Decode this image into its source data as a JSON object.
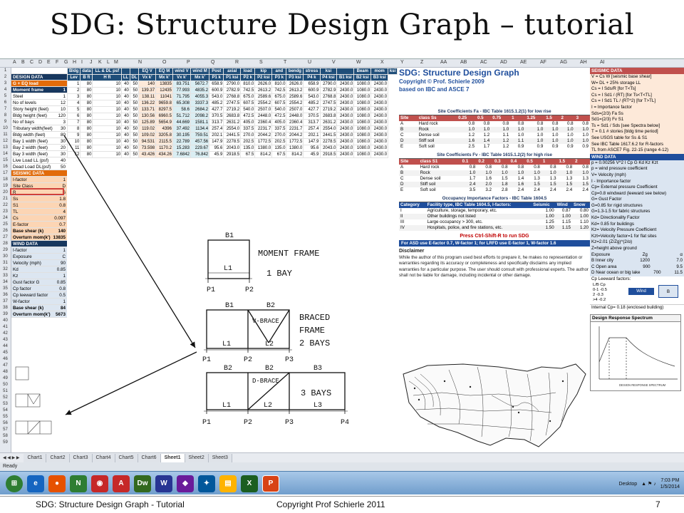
{
  "title": "SDG: Structure Design Graph – tutorial",
  "excel": {
    "columns": [
      "A",
      "B",
      "C",
      "D",
      "E",
      "F",
      "G",
      "H",
      "I",
      "J",
      "K",
      "L",
      "M",
      "N",
      "O",
      "P",
      "Q",
      "R",
      "S",
      "T",
      "U",
      "V",
      "W",
      "X",
      "Y",
      "Z",
      "AA",
      "AB",
      "AC",
      "AD",
      "AE",
      "AF",
      "AG",
      "AH",
      "AI"
    ],
    "rows": [
      "1",
      "2",
      "3",
      "4",
      "5",
      "6",
      "7",
      "8",
      "9",
      "10",
      "11",
      "12",
      "13",
      "14",
      "15",
      "16",
      "17",
      "18",
      "19",
      "20",
      "21",
      "22",
      "23",
      "24",
      "25",
      "26",
      "27",
      "28",
      "29",
      "30",
      "31",
      "32",
      "33",
      "34",
      "35",
      "36",
      "37",
      "38",
      "39",
      "40",
      "41",
      "42",
      "43",
      "44",
      "45",
      "46",
      "47",
      "48",
      "49",
      "50",
      "51",
      "52",
      "53",
      "54",
      "55",
      "56",
      "57",
      "58",
      "59"
    ],
    "left": [
      {
        "label": "",
        "value": "",
        "style": ""
      },
      {
        "label": "DESIGN DATA",
        "value": "",
        "style": "hb"
      },
      {
        "label": "G + EQ load",
        "value": "",
        "style": "h"
      },
      {
        "label": "Moment frame",
        "value": "1",
        "style": "hb"
      },
      {
        "label": "Steel",
        "value": "1",
        "style": ""
      },
      {
        "label": "No of levels",
        "value": "12",
        "style": ""
      },
      {
        "label": "Story height (feet)",
        "value": "10",
        "style": ""
      },
      {
        "label": "Bldg height (feet)",
        "value": "120",
        "style": ""
      },
      {
        "label": "No of bays",
        "value": "3",
        "style": ""
      },
      {
        "label": "Tributary width(feet)",
        "value": "30",
        "style": ""
      },
      {
        "label": "Bldg width (feet)",
        "value": "80",
        "style": ""
      },
      {
        "label": "Bay 1 width (feet)",
        "value": "30",
        "style": ""
      },
      {
        "label": "Bay 2 width (feet)",
        "value": "20",
        "style": ""
      },
      {
        "label": "Bay 3 width (feet)",
        "value": "30",
        "style": ""
      },
      {
        "label": "Live Load LL (psf)",
        "value": "40",
        "style": ""
      },
      {
        "label": "Dead Load DL(psf)",
        "value": "50",
        "style": ""
      },
      {
        "label": "SEISMIC DATA",
        "value": "",
        "style": "h"
      },
      {
        "label": "I-factor",
        "value": "1",
        "style": "o"
      },
      {
        "label": "Site Class",
        "value": "D",
        "style": "o"
      },
      {
        "label": "R",
        "value": "6",
        "style": "o"
      },
      {
        "label": "Ss",
        "value": "1.8",
        "style": "o"
      },
      {
        "label": "S1",
        "value": "0.8",
        "style": "o"
      },
      {
        "label": "TL",
        "value": "4",
        "style": "o"
      },
      {
        "label": "Cs",
        "value": "0.097",
        "style": "o"
      },
      {
        "label": "E-factor",
        "value": "0.7",
        "style": "o"
      },
      {
        "label": "Base shear (k)",
        "value": "140",
        "style": "o bold"
      },
      {
        "label": "Overturn mom(k')",
        "value": "13835",
        "style": "o bold"
      },
      {
        "label": "WIND DATA",
        "value": "",
        "style": "hb"
      },
      {
        "label": "I-factor",
        "value": "1",
        "style": "b"
      },
      {
        "label": "Exposure",
        "value": "C",
        "style": "b"
      },
      {
        "label": "Velocity (mph)",
        "value": "90",
        "style": "b"
      },
      {
        "label": "Kd",
        "value": "0.85",
        "style": "b"
      },
      {
        "label": "Kz",
        "value": "1",
        "style": "b"
      },
      {
        "label": "Gust factor G",
        "value": "0.85",
        "style": "b"
      },
      {
        "label": "Cp factor",
        "value": "0.8",
        "style": "b"
      },
      {
        "label": "Cp leeward factor",
        "value": "0.5",
        "style": "b"
      },
      {
        "label": "W-factor",
        "value": "1",
        "style": "b"
      },
      {
        "label": "Base shear (k)",
        "value": "84",
        "style": "b bold"
      },
      {
        "label": "Overturn mom(k')",
        "value": "5673",
        "style": "b bold"
      }
    ],
    "data_head1": [
      "Bldg",
      "data",
      "LL & DL psf",
      "",
      "",
      "EQ V",
      "EQ M",
      "wind V",
      "wind M",
      "Post",
      "axial",
      "load",
      "kip",
      "and",
      "bendg",
      "stress",
      "ksi",
      "",
      "Beam",
      "mom",
      "ksi"
    ],
    "data_head2": [
      "Lev",
      "B ft",
      "H ft",
      "LL",
      "DL",
      "Vx k'",
      "Mx k'",
      "Vx k'",
      "Mx k'",
      "P1 k",
      "P1 ksi",
      "P2 k",
      "P2 ksi",
      "P3 k",
      "P3 ksi",
      "P4 k",
      "P4 ksi",
      "B1 ksi",
      "B2 ksi",
      "B3 ksi"
    ],
    "data_rows": [
      [
        "1",
        "80",
        "10",
        "40",
        "50",
        "140",
        "13835",
        "83.751",
        "5672.7",
        "658.9",
        "2790.0",
        "810.0",
        "2626.0",
        "810.0",
        "2626.0",
        "658.9",
        "2790.0",
        "2430.0",
        "1080.0",
        "2430.0"
      ],
      [
        "2",
        "80",
        "10",
        "40",
        "50",
        "139.37",
        "12435",
        "77.993",
        "4835.2",
        "600.9",
        "2782.9",
        "742.5",
        "2613.2",
        "742.5",
        "2613.2",
        "600.9",
        "2782.9",
        "2430.0",
        "1080.0",
        "2430.0"
      ],
      [
        "3",
        "80",
        "10",
        "40",
        "50",
        "138.11",
        "11041",
        "71.795",
        "4055.3",
        "543.0",
        "2768.8",
        "675.0",
        "2589.6",
        "675.0",
        "2589.6",
        "543.0",
        "2768.8",
        "2430.0",
        "1080.0",
        "2430.0"
      ],
      [
        "4",
        "80",
        "10",
        "40",
        "50",
        "136.22",
        "9659.8",
        "65.308",
        "3337.3",
        "485.2",
        "2747.5",
        "607.5",
        "2554.2",
        "607.5",
        "2554.2",
        "485.2",
        "2747.5",
        "2430.0",
        "1080.0",
        "2430.0"
      ],
      [
        "5",
        "80",
        "10",
        "40",
        "50",
        "133.71",
        "8297.5",
        "58.6",
        "2684.2",
        "427.7",
        "2719.2",
        "540.0",
        "2507.0",
        "540.0",
        "2507.0",
        "427.7",
        "2719.2",
        "2430.0",
        "1080.0",
        "2430.0"
      ],
      [
        "6",
        "80",
        "10",
        "40",
        "50",
        "130.56",
        "6960.5",
        "51.712",
        "2098.2",
        "370.5",
        "2683.8",
        "472.5",
        "2448.0",
        "472.5",
        "2448.0",
        "370.5",
        "2683.8",
        "2430.0",
        "1080.0",
        "2430.0"
      ],
      [
        "7",
        "80",
        "10",
        "40",
        "50",
        "125.89",
        "5654.9",
        "44.669",
        "1581.1",
        "313.7",
        "2631.2",
        "405.0",
        "2360.4",
        "405.0",
        "2360.4",
        "313.7",
        "2631.2",
        "2430.0",
        "1080.0",
        "2430.0"
      ],
      [
        "8",
        "80",
        "10",
        "40",
        "50",
        "119.02",
        "4396",
        "37.492",
        "1134.4",
        "257.4",
        "2554.0",
        "337.5",
        "2231.7",
        "337.5",
        "2231.7",
        "257.4",
        "2554.0",
        "2430.0",
        "1080.0",
        "2430.0"
      ],
      [
        "9",
        "80",
        "10",
        "40",
        "50",
        "109.02",
        "3205.8",
        "30.195",
        "759.51",
        "202.1",
        "2441.5",
        "270.0",
        "2044.2",
        "270.0",
        "2044.2",
        "202.1",
        "2441.5",
        "2430.0",
        "1080.0",
        "2430.0"
      ],
      [
        "10",
        "80",
        "10",
        "40",
        "50",
        "94.531",
        "2115.5",
        "22.789",
        "457.56",
        "147.9",
        "2278.5",
        "202.5",
        "1772.5",
        "202.5",
        "1772.5",
        "147.9",
        "2278.5",
        "2430.0",
        "1080.0",
        "2430.0"
      ],
      [
        "11",
        "80",
        "10",
        "40",
        "50",
        "73.598",
        "1170.2",
        "15.283",
        "229.67",
        "95.6",
        "2043.0",
        "135.0",
        "1380.0",
        "135.0",
        "1380.0",
        "95.6",
        "2043.0",
        "2430.0",
        "1080.0",
        "2430.0"
      ],
      [
        "12",
        "80",
        "10",
        "40",
        "50",
        "43.426",
        "434.26",
        "7.6842",
        "76.842",
        "45.9",
        "2918.5",
        "67.5",
        "814.2",
        "67.5",
        "814.2",
        "45.9",
        "2918.5",
        "2430.0",
        "1080.0",
        "2430.0"
      ]
    ],
    "sdg_title": "SDG: Structure Design Graph",
    "sdg_copyright": "Copyright © Prof. Schierle 2009",
    "sdg_based": "based on IBC and ASCE 7",
    "fa_caption": "Site Coefficients Fa - IBC Table 1615.1.2(1) for low rise",
    "fa_head": [
      "Site",
      "class Ss",
      "0.25",
      "0.5",
      "0.75",
      "1",
      "1.25",
      "1.5",
      "2",
      "3"
    ],
    "fa_rows": [
      [
        "A",
        "Hard rock",
        "0.8",
        "0.8",
        "0.8",
        "0.8",
        "0.8",
        "0.8",
        "0.8",
        "0.8"
      ],
      [
        "B",
        "Rock",
        "1.0",
        "1.0",
        "1.0",
        "1.0",
        "1.0",
        "1.0",
        "1.0",
        "1.0"
      ],
      [
        "C",
        "Dense soil",
        "1.2",
        "1.2",
        "1.1",
        "1.0",
        "1.0",
        "1.0",
        "1.0",
        "1.0"
      ],
      [
        "D",
        "Stiff soil",
        "1.6",
        "1.4",
        "1.2",
        "1.1",
        "1.0",
        "1.0",
        "1.0",
        "1.0"
      ],
      [
        "E",
        "Soft soil",
        "2.5",
        "1.7",
        "1.2",
        "0.9",
        "0.9",
        "0.9",
        "0.9",
        "0.9"
      ]
    ],
    "fv_caption": "Site Coefficients Fv - IBC Table 1615.1.2(2) for high rise",
    "fv_head": [
      "Site",
      "class S1",
      "0.1",
      "0.2",
      "0.3",
      "0.4",
      "0.5",
      "1",
      "1.5",
      "2"
    ],
    "fv_rows": [
      [
        "A",
        "Hard rock",
        "0.8",
        "0.8",
        "0.8",
        "0.8",
        "0.8",
        "0.8",
        "0.8",
        "0.8"
      ],
      [
        "B",
        "Rock",
        "1.0",
        "1.0",
        "1.0",
        "1.0",
        "1.0",
        "1.0",
        "1.0",
        "1.0"
      ],
      [
        "C",
        "Dense soil",
        "1.7",
        "1.6",
        "1.5",
        "1.4",
        "1.3",
        "1.3",
        "1.3",
        "1.3"
      ],
      [
        "D",
        "Stiff soil",
        "2.4",
        "2.0",
        "1.8",
        "1.6",
        "1.5",
        "1.5",
        "1.5",
        "1.5"
      ],
      [
        "E",
        "Soft soil",
        "3.5",
        "3.2",
        "2.8",
        "2.4",
        "2.4",
        "2.4",
        "2.4",
        "2.4"
      ]
    ],
    "occ_caption": "Occupancy Importance Factors - IBC Table 1604.5",
    "occ_head": [
      "Category",
      "Facility type, IBC Table 1604.5, I-factors:",
      "Seismic",
      "Wind",
      "Snow"
    ],
    "occ_rows": [
      [
        "I",
        "Agriculture, storage, temporary, etc.",
        "1.00",
        "0.87",
        "0.80"
      ],
      [
        "II",
        "Other buildings not listed",
        "1.00",
        "1.00",
        "1.00"
      ],
      [
        "III",
        "Large occupancy > 300, etc.",
        "1.25",
        "1.15",
        "1.10"
      ],
      [
        "IV",
        "Hospitals, police, and fire stations, etc.",
        "1.50",
        "1.15",
        "1.20"
      ]
    ],
    "press": "Press Ctrl-Shift-R to run SDG",
    "asd": "For ASD use E-factor 0.7, W-factor 1; for LRFD use E-factor 1, W-factor 1.6",
    "disclaimer_title": "Disclaimer",
    "disclaimer_text": "While the author of this program used best efforts to prepare it, he makes no representation or warranties regarding its accuracy or completeness and specifically disclaims any implied warranties for a particular purpose. The user should consult with professional experts. The author shall not be liable for damage, including incidental or other damage.",
    "seismic_title": "SEISMIC DATA",
    "seismic_lines": [
      "V = Cs W     [seismic base shear]",
      "W= DL + 25% storage LL",
      "Cs = I Sds/R                 [for T<Ts]",
      "Cs = I Sd1 / (RT)        [for Ts<T<TL]",
      "Cs = I Sd1 TL / (RT^2)     [for T>TL]",
      "I = Importance factor",
      "Sds=(2/3) Fa Ss",
      "Sd1=(2/3) Fv S1",
      "Ts = Sd1 / Sds  [see Spectra below]",
      "T = 0.1 # stories  [bldg time period]",
      "See USGS table for Ss & S1",
      "See IBC Table 1617.6.2 for R-factors",
      "TL from ASCE7 Fig. 22-15 (range 4-12)"
    ],
    "wind_title": "WIND DATA",
    "wind_lines": [
      "p = 0.00256 V^2 I Cp G Kd Kz Kzt",
      "p = wind pressure coefficient",
      "V= Velocity (mph)",
      "I - Importance factor",
      "Cp= External pressure Coefficient",
      "Cp=0.8 windward (leeward see below)",
      "G= Gust Factor",
      "G=0.85 for rigid structures",
      "G=1.3-1.5 for fabric structures",
      "Kd= Directionality Factor",
      "Kd= 0.85 for buildings",
      "Kz= Velocity Pressure Coefficient",
      "Kzt=Velocity factor=1 for flat sites",
      "Kz=2.01 (Z/Zg)^(2/α)",
      "Z=height above ground"
    ],
    "exposure_head": [
      "Exposure",
      "Zg",
      "α"
    ],
    "exposure_rows": [
      [
        "B  Inner city",
        "1200",
        "7.0"
      ],
      [
        "C  Open area",
        "900",
        "9.5"
      ],
      [
        "D  Near ocean or big lake",
        "700",
        "11.5"
      ]
    ],
    "cp_title": "Cp    Leeward factors:",
    "cp_rows": [
      [
        "L/B",
        "Cp"
      ],
      [
        "0-1",
        "-0.5"
      ],
      [
        "2",
        "-0.3"
      ],
      [
        ">4",
        "-0.2"
      ]
    ],
    "wind_word": "Wind",
    "internal_cp": "Internal Cp= 0.18 (enclosed building)",
    "spectrum_title": "Design Response Spectrum",
    "spectrum_axis": "DESIGN RESPONSE SPECTRUM",
    "tabs": [
      "Chart1",
      "Chart2",
      "Chart3",
      "Chart4",
      "Chart5",
      "Chart6",
      "Sheet1",
      "Sheet2",
      "Sheet3"
    ],
    "active_tab": "Sheet1",
    "status": "Ready",
    "tray_desktop": "Desktop",
    "tray_time": "7:03 PM",
    "tray_date": "1/5/2014"
  },
  "frames": {
    "f1_title": "MOMENT FRAME",
    "f1_sub": "1 BAY",
    "f2_title": "BRACED",
    "f2_sub": "FRAME",
    "f2_bays": "2 BAYS",
    "f2_brace": "V-BRACE",
    "f3_bays": "3 BAYS",
    "f3_brace": "D-BRACE"
  },
  "footer": {
    "left": "SDG: Structure Design Graph - Tutorial",
    "center": "Copyright Prof Schierle 2011",
    "page": "7"
  }
}
